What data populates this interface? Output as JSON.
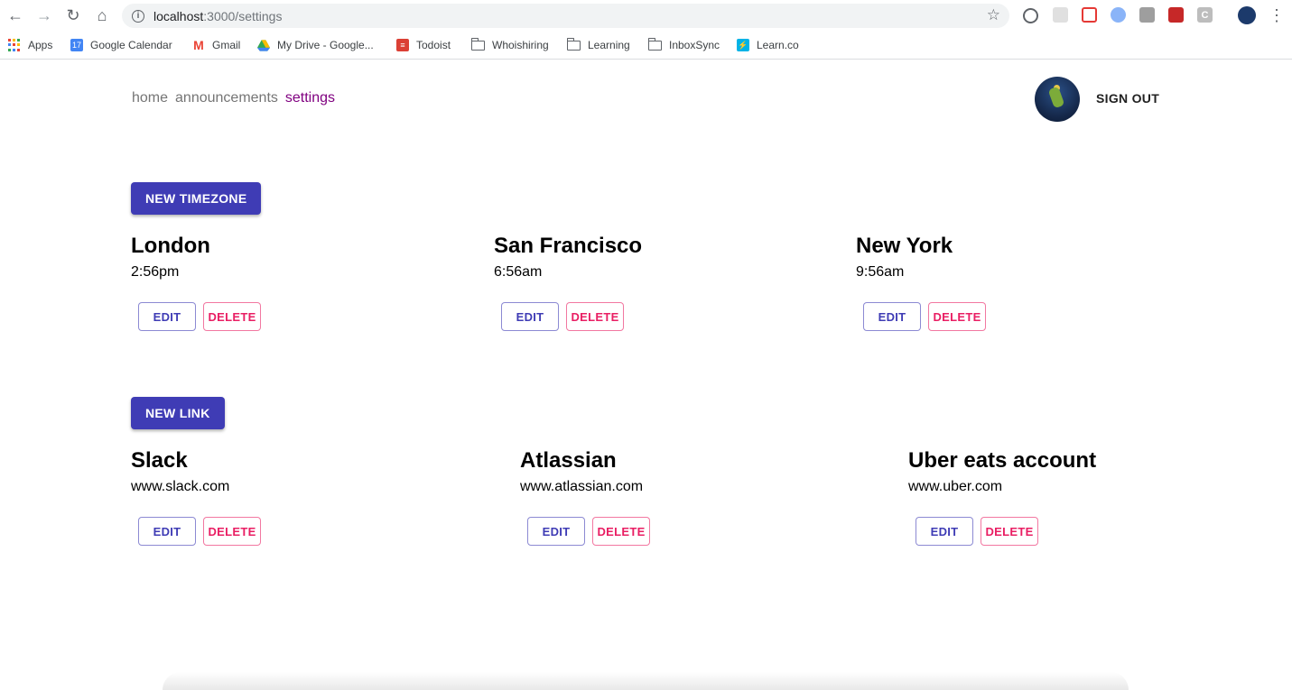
{
  "browser": {
    "url_host": "localhost",
    "url_path": ":3000/settings",
    "bookmarks": [
      "Apps",
      "Google Calendar",
      "Gmail",
      "My Drive - Google...",
      "Todoist",
      "Whoishiring",
      "Learning",
      "InboxSync",
      "Learn.co"
    ],
    "calendar_day": "17"
  },
  "nav": {
    "home": "home",
    "announcements": "announcements",
    "settings": "settings"
  },
  "header": {
    "signout": "SIGN OUT"
  },
  "timezones": {
    "new_button": "NEW TIMEZONE",
    "items": [
      {
        "name": "London",
        "time": "2:56pm"
      },
      {
        "name": "San Francisco",
        "time": "6:56am"
      },
      {
        "name": "New York",
        "time": "9:56am"
      }
    ]
  },
  "links": {
    "new_button": "NEW LINK",
    "items": [
      {
        "name": "Slack",
        "url": "www.slack.com"
      },
      {
        "name": "Atlassian",
        "url": "www.atlassian.com"
      },
      {
        "name": "Uber eats account",
        "url": "www.uber.com"
      }
    ]
  },
  "actions": {
    "edit": "EDIT",
    "delete": "DELETE"
  },
  "colors": {
    "primary": "#3f3cb5",
    "danger": "#e91e63",
    "active_nav": "#800080"
  }
}
